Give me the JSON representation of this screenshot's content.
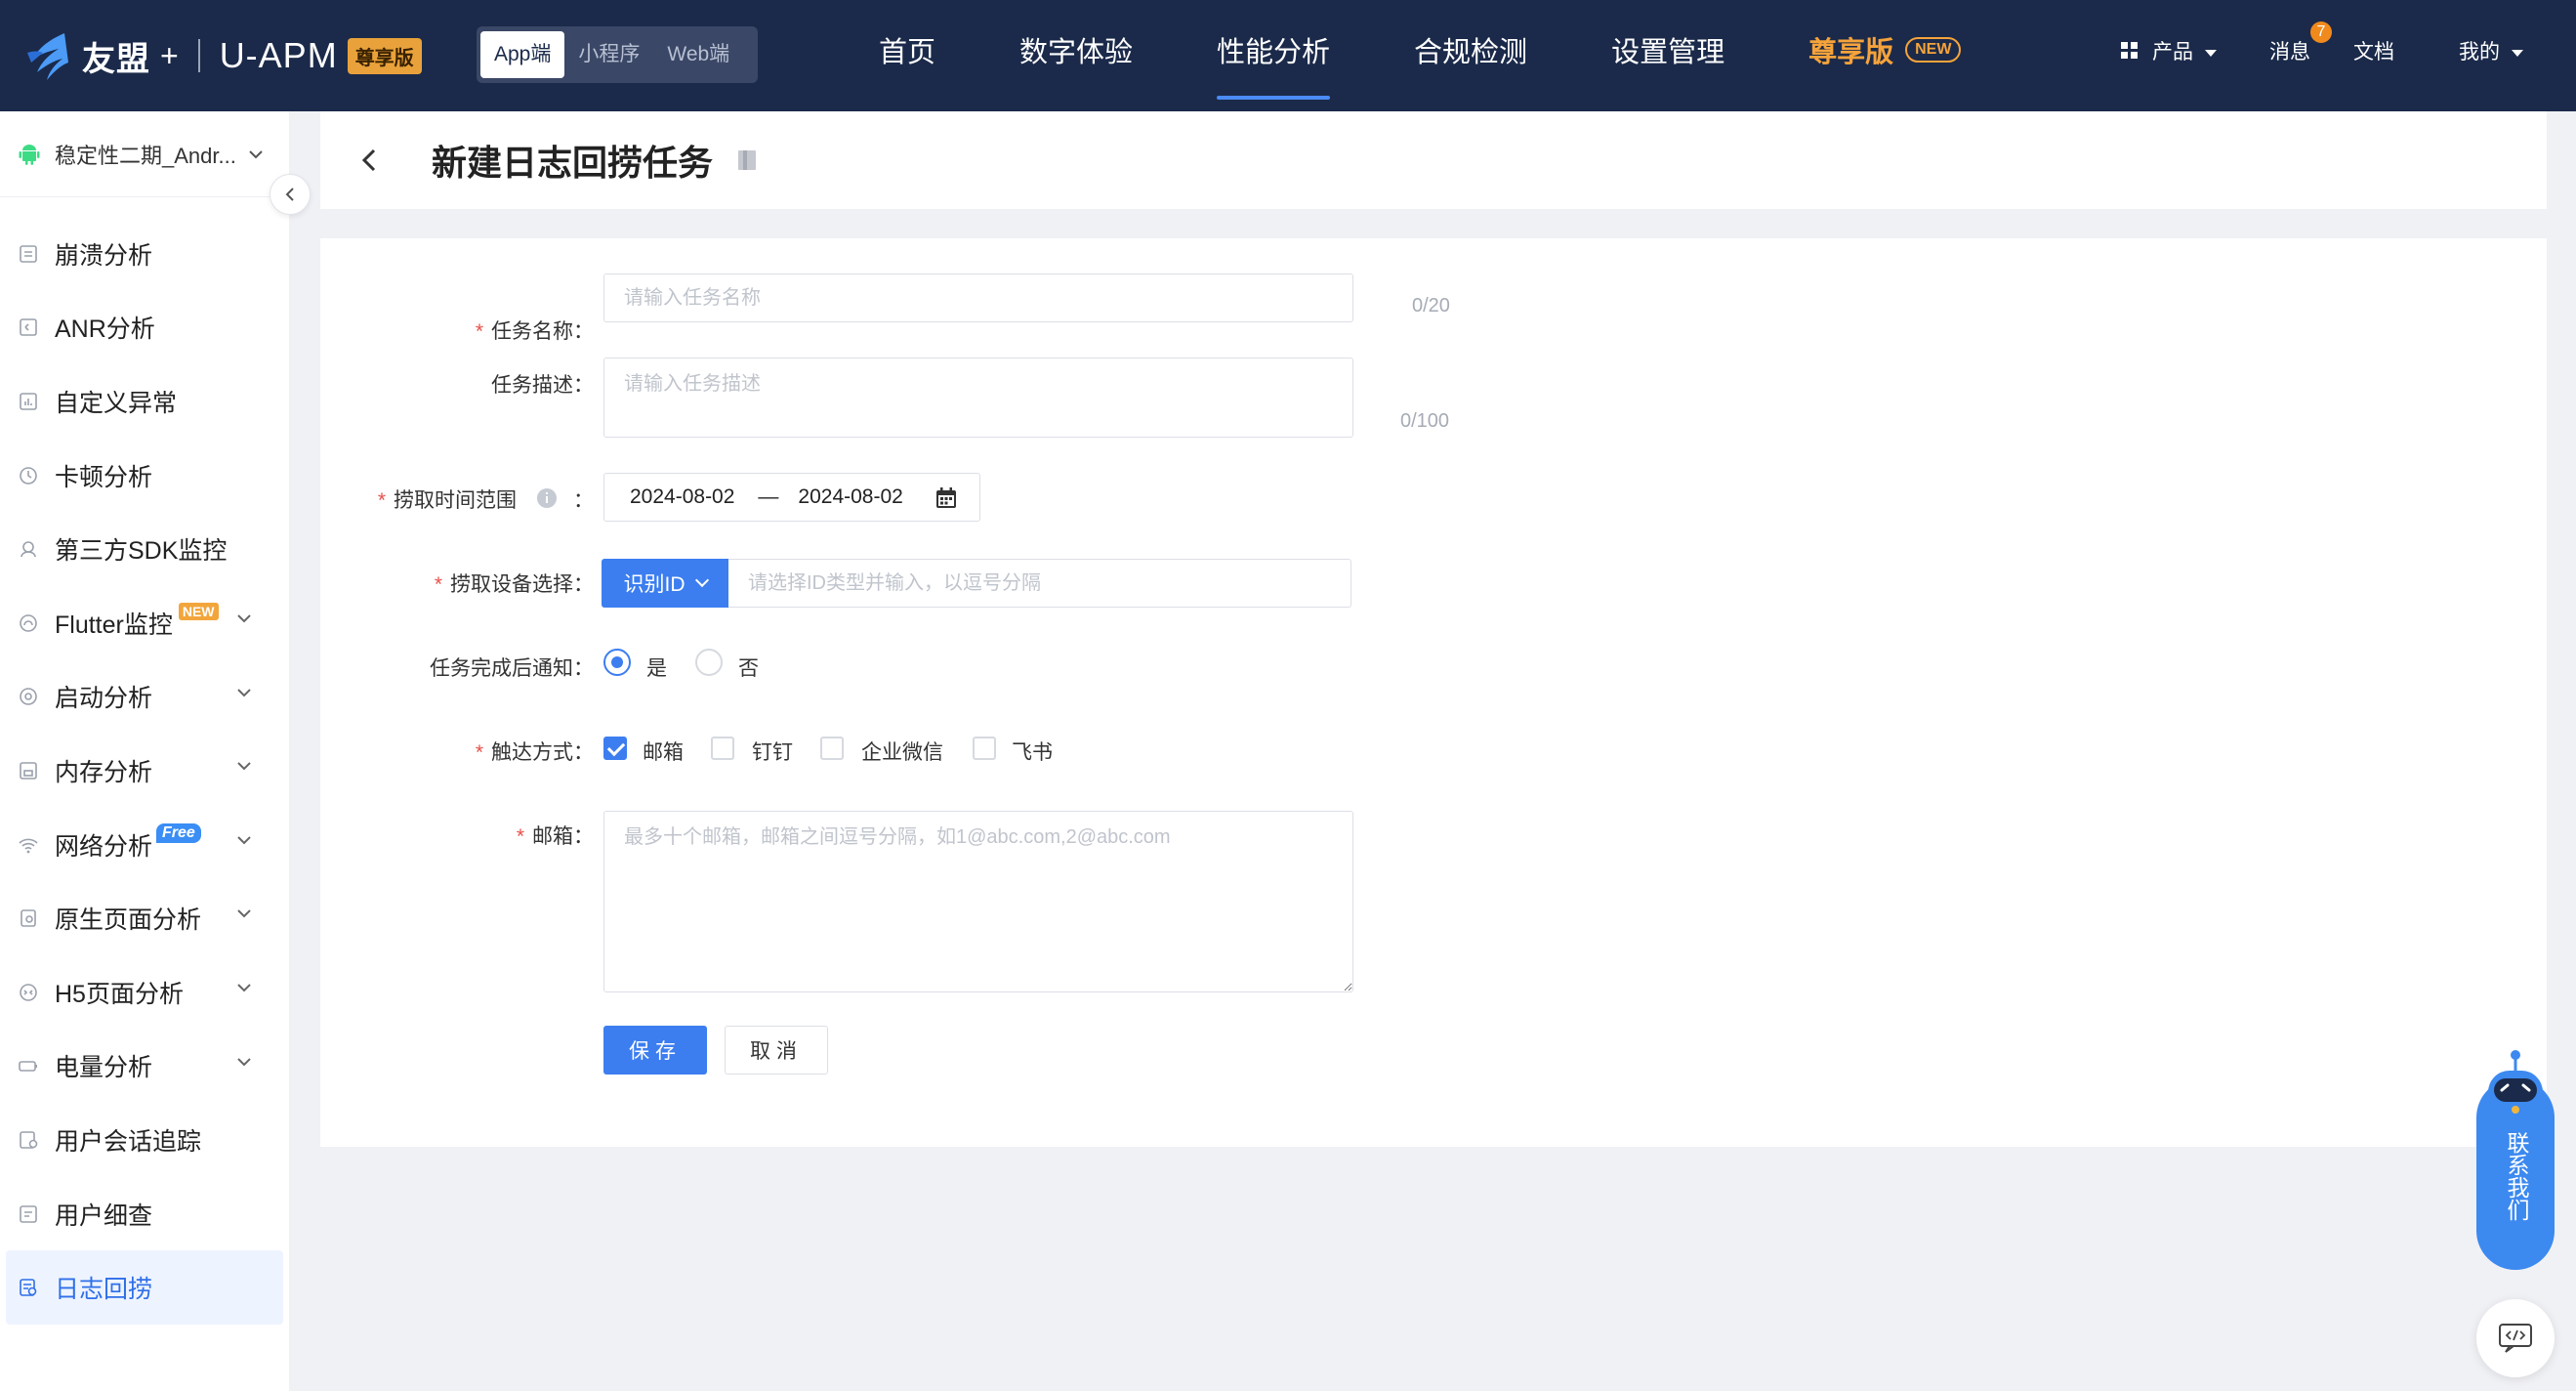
{
  "topbar": {
    "brand": "友盟",
    "brand_plus": "+",
    "product": "U-APM",
    "edition_badge": "尊享版",
    "platforms": [
      {
        "label": "App端",
        "active": true
      },
      {
        "label": "小程序",
        "active": false
      },
      {
        "label": "Web端",
        "active": false
      }
    ],
    "nav": [
      {
        "label": "首页"
      },
      {
        "label": "数字体验"
      },
      {
        "label": "性能分析",
        "active": true
      },
      {
        "label": "合规检测"
      },
      {
        "label": "设置管理"
      }
    ],
    "vip_label": "尊享版",
    "vip_new": "NEW",
    "products_label": "产品",
    "messages_label": "消息",
    "messages_count": "7",
    "docs_label": "文档",
    "mine_label": "我的"
  },
  "sidebar": {
    "app_name": "稳定性二期_Andr...",
    "items": [
      {
        "label": "崩溃分析",
        "icon": "crash-icon"
      },
      {
        "label": "ANR分析",
        "icon": "anr-icon"
      },
      {
        "label": "自定义异常",
        "icon": "chart-icon"
      },
      {
        "label": "卡顿分析",
        "icon": "lag-icon"
      },
      {
        "label": "第三方SDK监控",
        "icon": "sdk-icon"
      },
      {
        "label": "Flutter监控",
        "icon": "flutter-icon",
        "tag": "NEW",
        "expandable": true
      },
      {
        "label": "启动分析",
        "icon": "launch-icon",
        "expandable": true
      },
      {
        "label": "内存分析",
        "icon": "memory-icon",
        "expandable": true
      },
      {
        "label": "网络分析",
        "icon": "wifi-icon",
        "tag": "Free",
        "expandable": true
      },
      {
        "label": "原生页面分析",
        "icon": "page-icon",
        "expandable": true
      },
      {
        "label": "H5页面分析",
        "icon": "h5-icon",
        "expandable": true
      },
      {
        "label": "电量分析",
        "icon": "battery-icon",
        "expandable": true
      },
      {
        "label": "用户会话追踪",
        "icon": "session-icon"
      },
      {
        "label": "用户细查",
        "icon": "user-detail-icon"
      },
      {
        "label": "日志回捞",
        "icon": "log-icon",
        "active": true
      }
    ]
  },
  "page": {
    "title": "新建日志回捞任务"
  },
  "form": {
    "task_name": {
      "label": "任务名称：",
      "placeholder": "请输入任务名称",
      "value": "",
      "counter": "0/20"
    },
    "task_desc": {
      "label": "任务描述：",
      "placeholder": "请输入任务描述",
      "value": "",
      "counter": "0/100"
    },
    "time_range": {
      "label": "捞取时间范围",
      "colon": "：",
      "start": "2024-08-02",
      "separator": "—",
      "end": "2024-08-02"
    },
    "device": {
      "label": "捞取设备选择：",
      "type_label": "识别ID",
      "placeholder": "请选择ID类型并输入，以逗号分隔",
      "value": ""
    },
    "notify": {
      "label": "任务完成后通知：",
      "options": [
        {
          "label": "是",
          "checked": true
        },
        {
          "label": "否",
          "checked": false
        }
      ]
    },
    "channels": {
      "label": "触达方式：",
      "options": [
        {
          "label": "邮箱",
          "checked": true
        },
        {
          "label": "钉钉",
          "checked": false
        },
        {
          "label": "企业微信",
          "checked": false
        },
        {
          "label": "飞书",
          "checked": false
        }
      ]
    },
    "email": {
      "label": "邮箱：",
      "placeholder": "最多十个邮箱，邮箱之间逗号分隔，如1@abc.com,2@abc.com",
      "value": ""
    },
    "save_label": "保存",
    "cancel_label": "取消"
  },
  "widgets": {
    "contact_label": "联系我们"
  },
  "colors": {
    "topbar_bg": "#1b2a4a",
    "primary": "#3c7ef0",
    "vip": "#f5a33b",
    "required": "#e8504a"
  }
}
